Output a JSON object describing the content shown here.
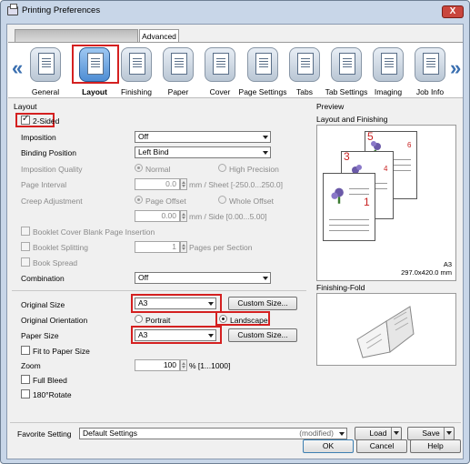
{
  "window": {
    "title": "Printing Preferences",
    "close": "X"
  },
  "tabs": {
    "advanced": "Advanced"
  },
  "toolbar": {
    "prev_arrow": "«",
    "next_arrow": "»",
    "items": [
      {
        "label": "General"
      },
      {
        "label": "Layout"
      },
      {
        "label": "Finishing"
      },
      {
        "label": "Paper"
      },
      {
        "label": "Cover"
      },
      {
        "label": "Page Settings"
      },
      {
        "label": "Tabs"
      },
      {
        "label": "Tab Settings"
      },
      {
        "label": "Imaging"
      },
      {
        "label": "Job Info"
      }
    ]
  },
  "layout": {
    "section": "Layout",
    "two_sided": "2-Sided",
    "imposition_label": "Imposition",
    "imposition_value": "Off",
    "binding_label": "Binding Position",
    "binding_value": "Left Bind",
    "imp_quality_label": "Imposition Quality",
    "normal": "Normal",
    "high_precision": "High Precision",
    "page_interval_label": "Page Interval",
    "page_interval_value": "0.0",
    "page_interval_unit": "mm / Sheet [-250.0...250.0]",
    "creep_label": "Creep Adjustment",
    "page_offset": "Page Offset",
    "whole_offset": "Whole Offset",
    "creep_value": "0.00",
    "creep_unit": "mm / Side [0.00...5.00]",
    "booklet_cover": "Booklet Cover Blank Page Insertion",
    "booklet_split": "Booklet Splitting",
    "booklet_split_value": "1",
    "pages_per_section": "Pages per Section",
    "book_spread": "Book Spread",
    "combination_label": "Combination",
    "combination_value": "Off"
  },
  "paper": {
    "original_size_label": "Original Size",
    "original_size_value": "A3",
    "custom_size_btn": "Custom Size...",
    "orientation_label": "Original Orientation",
    "portrait": "Portrait",
    "landscape": "Landscape",
    "paper_size_label": "Paper Size",
    "paper_size_value": "A3",
    "custom_size_btn2": "Custom Size...",
    "fit_to_paper": "Fit to Paper Size",
    "zoom_label": "Zoom",
    "zoom_value": "100",
    "zoom_unit": "% [1...1000]",
    "full_bleed": "Full Bleed",
    "rotate": "180°Rotate"
  },
  "preview": {
    "section": "Preview",
    "title": "Layout and Finishing",
    "page_numbers": [
      "5",
      "3",
      "1",
      "6",
      "4"
    ],
    "paper": "A3",
    "dims": "297.0x420.0 mm",
    "fold_title": "Finishing-Fold"
  },
  "footer": {
    "favorite_label": "Favorite Setting",
    "favorite_value": "Default Settings",
    "modified": "(modified)",
    "load": "Load",
    "save": "Save",
    "ok": "OK",
    "cancel": "Cancel",
    "help": "Help"
  }
}
